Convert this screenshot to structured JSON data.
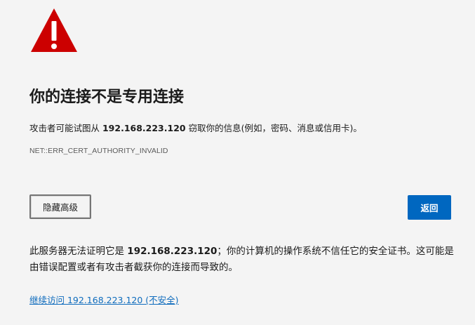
{
  "icon": {
    "name": "warning-triangle-icon",
    "color": "#cc0000"
  },
  "title": "你的连接不是专用连接",
  "description": {
    "prefix": "攻击者可能试图从 ",
    "host": "192.168.223.120",
    "suffix": " 窃取你的信息(例如，密码、消息或信用卡)。"
  },
  "error_code": "NET::ERR_CERT_AUTHORITY_INVALID",
  "buttons": {
    "advanced_label": "隐藏高级",
    "back_label": "返回"
  },
  "details": {
    "prefix": "此服务器无法证明它是 ",
    "host": "192.168.223.120",
    "suffix": "；你的计算机的操作系统不信任它的安全证书。这可能是由错误配置或者有攻击者截获你的连接而导致的。"
  },
  "continue_link": "继续访问 192.168.223.120 (不安全)",
  "colors": {
    "background": "#f4f4f4",
    "accent": "#0067c0",
    "link": "#0f6cbd",
    "warning": "#cc0000"
  }
}
